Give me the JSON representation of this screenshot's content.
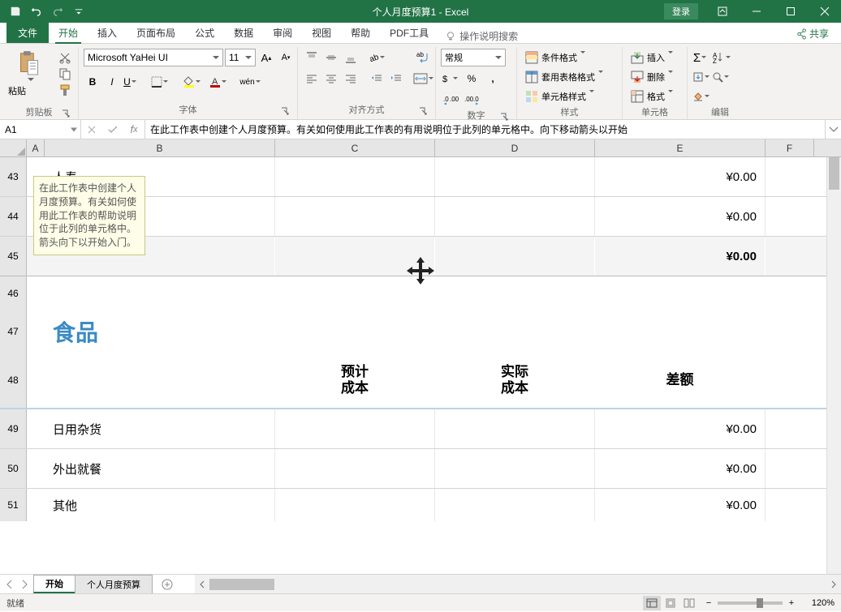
{
  "title": "个人月度预算1 - Excel",
  "login_button": "登录",
  "tabs": {
    "file": "文件",
    "home": "开始",
    "insert": "插入",
    "page_layout": "页面布局",
    "formulas": "公式",
    "data": "数据",
    "review": "审阅",
    "view": "视图",
    "help": "帮助",
    "pdf": "PDF工具",
    "tell_me": "操作说明搜索"
  },
  "share": "共享",
  "ribbon": {
    "clipboard": {
      "paste": "粘贴",
      "group": "剪贴板"
    },
    "font": {
      "name": "Microsoft YaHei UI",
      "size": "11",
      "group": "字体"
    },
    "alignment": {
      "group": "对齐方式"
    },
    "number": {
      "format": "常规",
      "group": "数字"
    },
    "styles": {
      "conditional": "条件格式",
      "table": "套用表格格式",
      "cell": "单元格样式",
      "group": "样式"
    },
    "cells": {
      "insert": "插入",
      "delete": "删除",
      "format": "格式",
      "group": "单元格"
    },
    "editing": {
      "group": "编辑"
    }
  },
  "name_box": "A1",
  "formula": "在此工作表中创建个人月度预算。有关如何使用此工作表的有用说明位于此列的单元格中。向下移动箭头以开始",
  "tooltip": "在此工作表中创建个人月度预算。有关如何使用此工作表的帮助说明位于此列的单元格中。箭头向下以开始入门。",
  "columns": [
    "A",
    "B",
    "C",
    "D",
    "E",
    "F"
  ],
  "sheet": {
    "rows": {
      "43": {
        "B": "人寿",
        "E": "¥0.00"
      },
      "44": {
        "E": "¥0.00"
      },
      "45": {
        "E": "¥0.00"
      },
      "46": {},
      "47": {
        "B": "食品"
      },
      "48": {
        "C1": "预计",
        "C2": "成本",
        "D1": "实际",
        "D2": "成本",
        "E": "差额"
      },
      "49": {
        "B": "日用杂货",
        "E": "¥0.00"
      },
      "50": {
        "B": "外出就餐",
        "E": "¥0.00"
      },
      "51": {
        "B": "其他",
        "E": "¥0.00"
      }
    }
  },
  "sheet_tabs": {
    "active": "开始",
    "other": "个人月度预算"
  },
  "status": {
    "ready": "就绪",
    "zoom": "120%"
  }
}
